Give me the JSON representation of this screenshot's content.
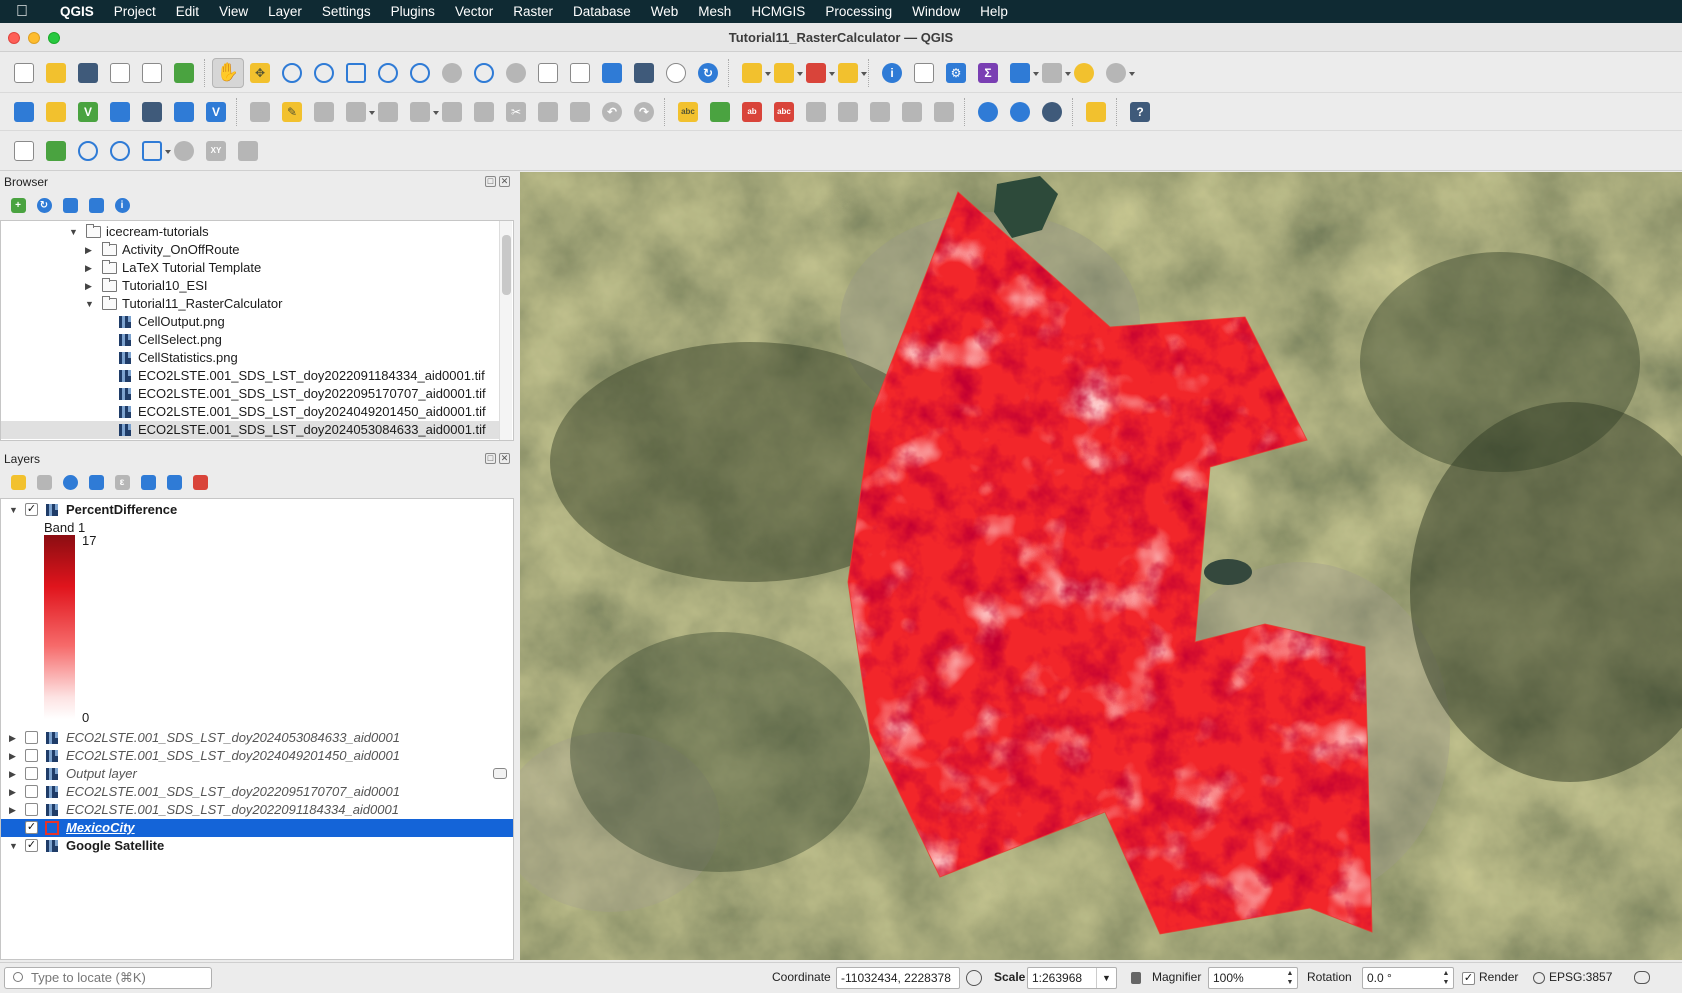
{
  "menubar": {
    "app": "QGIS",
    "items": [
      "Project",
      "Edit",
      "View",
      "Layer",
      "Settings",
      "Plugins",
      "Vector",
      "Raster",
      "Database",
      "Web",
      "Mesh",
      "HCMGIS",
      "Processing",
      "Window",
      "Help"
    ]
  },
  "window": {
    "title": "Tutorial11_RasterCalculator — QGIS"
  },
  "browser": {
    "title": "Browser",
    "items": [
      {
        "label": "icecream-tutorials",
        "kind": "folder",
        "expanded": true,
        "depth": 0
      },
      {
        "label": "Activity_OnOffRoute",
        "kind": "folder",
        "expanded": false,
        "depth": 1
      },
      {
        "label": "LaTeX Tutorial Template",
        "kind": "folder",
        "expanded": false,
        "depth": 1
      },
      {
        "label": "Tutorial10_ESI",
        "kind": "folder",
        "expanded": false,
        "depth": 1
      },
      {
        "label": "Tutorial11_RasterCalculator",
        "kind": "folder",
        "expanded": true,
        "depth": 1
      },
      {
        "label": "CellOutput.png",
        "kind": "raster",
        "depth": 2
      },
      {
        "label": "CellSelect.png",
        "kind": "raster",
        "depth": 2
      },
      {
        "label": "CellStatistics.png",
        "kind": "raster",
        "depth": 2
      },
      {
        "label": "ECO2LSTE.001_SDS_LST_doy2022091184334_aid0001.tif",
        "kind": "raster",
        "depth": 2
      },
      {
        "label": "ECO2LSTE.001_SDS_LST_doy2022095170707_aid0001.tif",
        "kind": "raster",
        "depth": 2
      },
      {
        "label": "ECO2LSTE.001_SDS_LST_doy2024049201450_aid0001.tif",
        "kind": "raster",
        "depth": 2
      },
      {
        "label": "ECO2LSTE.001_SDS_LST_doy2024053084633_aid0001.tif",
        "kind": "raster",
        "depth": 2,
        "selected": true
      }
    ]
  },
  "layers": {
    "title": "Layers",
    "top_layer": {
      "name": "PercentDifference",
      "checked": true,
      "band_label": "Band 1",
      "legend_max": "17",
      "legend_min": "0"
    },
    "items": [
      {
        "name": "ECO2LSTE.001_SDS_LST_doy2024053084633_aid0001",
        "checked": false,
        "style": "ital"
      },
      {
        "name": "ECO2LSTE.001_SDS_LST_doy2024049201450_aid0001",
        "checked": false,
        "style": "ital"
      },
      {
        "name": "Output layer",
        "checked": false,
        "style": "ital"
      },
      {
        "name": "ECO2LSTE.001_SDS_LST_doy2022095170707_aid0001",
        "checked": false,
        "style": "ital"
      },
      {
        "name": "ECO2LSTE.001_SDS_LST_doy2022091184334_aid0001",
        "checked": false,
        "style": "ital"
      },
      {
        "name": "MexicoCity",
        "checked": true,
        "style": "link",
        "selected": true
      },
      {
        "name": "Google Satellite",
        "checked": true,
        "style": "bold"
      }
    ]
  },
  "statusbar": {
    "locator_placeholder": "Type to locate (⌘K)",
    "coordinate_label": "Coordinate",
    "coordinate_value": "-11032434, 2228378",
    "scale_label": "Scale",
    "scale_value": "1:263968",
    "magnifier_label": "Magnifier",
    "magnifier_value": "100%",
    "rotation_label": "Rotation",
    "rotation_value": "0.0 °",
    "render_label": "Render",
    "render_checked": true,
    "crs": "EPSG:3857"
  },
  "colors": {
    "accent": "#1464d8",
    "raster_red": "#f2262a",
    "menubar": "#0f2a33"
  }
}
